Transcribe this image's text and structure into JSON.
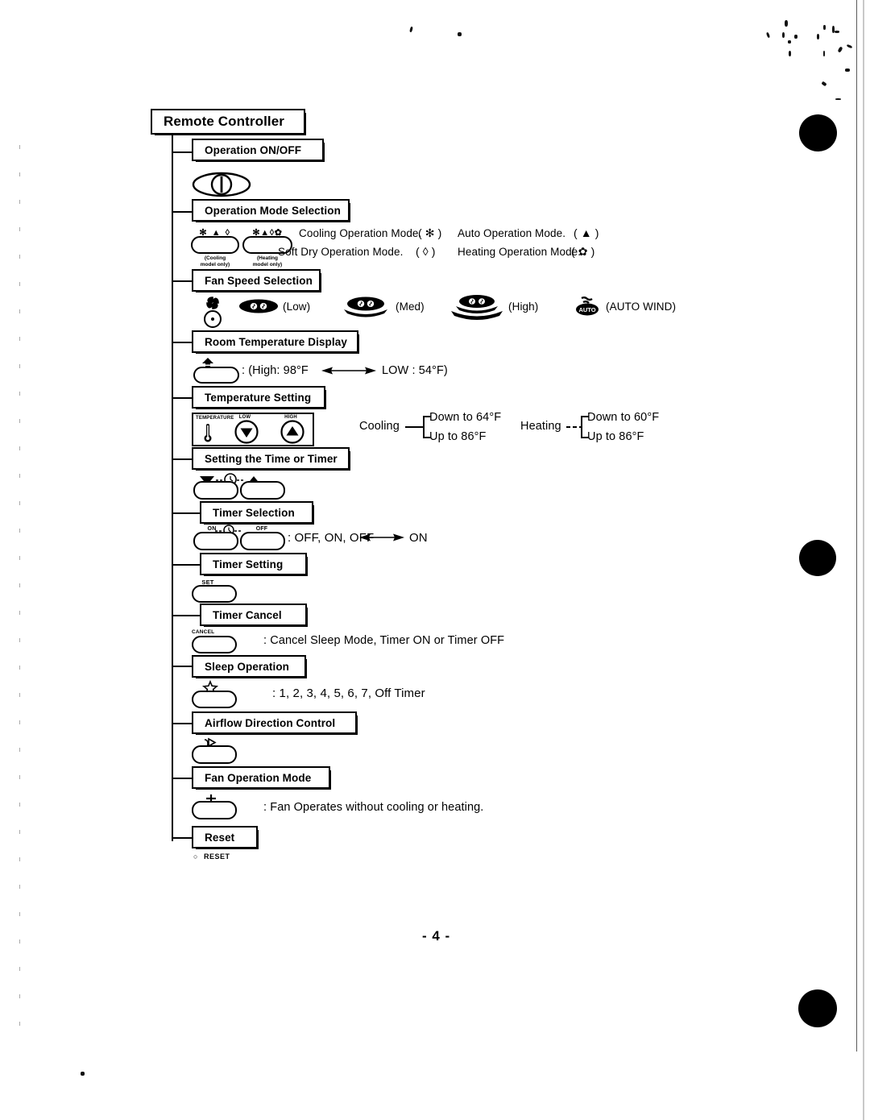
{
  "document": {
    "page_number": "- 4 -",
    "root_title": "Remote Controller"
  },
  "sections": [
    {
      "id": "operation-on-off",
      "title": "Operation ON/OFF",
      "icon": "power-button-icon",
      "description": ""
    },
    {
      "id": "operation-mode-selection",
      "title": "Operation Mode Selection",
      "button_a_caption": "✻ ▲ ◊",
      "button_a_note_line1": "(Cooling",
      "button_a_note_line2": "model only)",
      "button_b_caption": "✻▲◊✿",
      "button_b_note_line1": "(Heating",
      "button_b_note_line2": "model only)",
      "modes": [
        {
          "label": "Cooling Operation Mode.",
          "symbol": "( ✻ )"
        },
        {
          "label": "Auto Operation Mode.",
          "symbol": "( ▲ )"
        },
        {
          "label": "Soft Dry Operation Mode.",
          "symbol": "( ◊ )"
        },
        {
          "label": "Heating Operation Mode.",
          "symbol": "( ✿ )"
        }
      ]
    },
    {
      "id": "fan-speed-selection",
      "title": "Fan Speed Selection",
      "speeds": [
        {
          "label": "(Low)",
          "icon": "fan-low-icon"
        },
        {
          "label": "(Med)",
          "icon": "fan-med-icon"
        },
        {
          "label": "(High)",
          "icon": "fan-high-icon"
        },
        {
          "label": "(AUTO WIND)",
          "icon": "fan-auto-wind-icon"
        }
      ]
    },
    {
      "id": "room-temperature-display",
      "title": "Room Temperature Display",
      "icon": "room-temp-icon",
      "range_text_left": ": (High: 98°F",
      "range_text_right": "LOW : 54°F)"
    },
    {
      "id": "temperature-setting",
      "title": "Temperature Setting",
      "panel_label": "TEMPERATURE",
      "panel_low_label": "LOW",
      "panel_high_label": "HIGH",
      "ranges": [
        {
          "mode": "Cooling",
          "down": "Down to 64°F",
          "up": "Up to 86°F"
        },
        {
          "mode": "Heating",
          "down": "Down to 60°F",
          "up": "Up to 86°F"
        }
      ]
    },
    {
      "id": "setting-time-or-timer",
      "title": "Setting the Time or Timer",
      "icon": "clock-up-down-icon"
    },
    {
      "id": "timer-selection",
      "title": "Timer Selection",
      "button_left_caption": "ON",
      "button_right_caption": "OFF",
      "description_left": ": OFF, ON, OFF",
      "description_right": "ON"
    },
    {
      "id": "timer-setting",
      "title": "Timer Setting",
      "button_caption": "SET",
      "description": ""
    },
    {
      "id": "timer-cancel",
      "title": "Timer Cancel",
      "button_caption": "CANCEL",
      "description": ": Cancel Sleep Mode, Timer ON or Timer OFF"
    },
    {
      "id": "sleep-operation",
      "title": "Sleep Operation",
      "icon": "star-icon",
      "description": ": 1, 2, 3, 4, 5, 6, 7, Off Timer"
    },
    {
      "id": "airflow-direction-control",
      "title": "Airflow Direction Control",
      "icon": "airflow-flap-icon",
      "description": ""
    },
    {
      "id": "fan-operation-mode",
      "title": "Fan Operation Mode",
      "icon": "fan-plus-icon",
      "description": ": Fan Operates without cooling or heating."
    },
    {
      "id": "reset",
      "title": "Reset",
      "button_caption": "RESET",
      "bullet": "○",
      "description": ""
    }
  ]
}
